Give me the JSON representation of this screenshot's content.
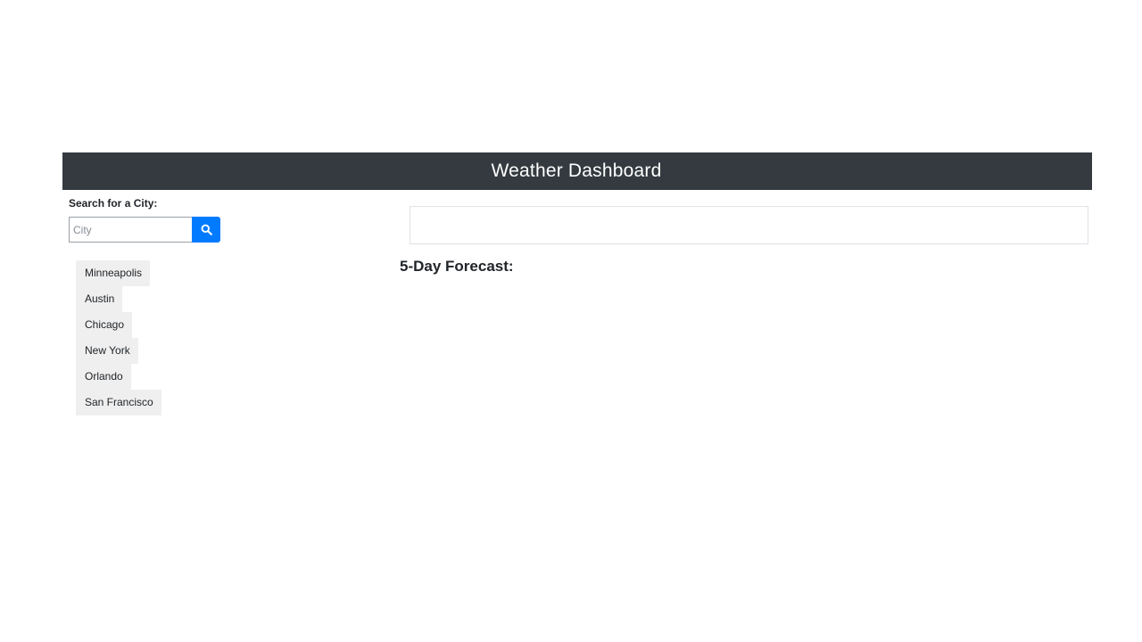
{
  "header": {
    "title": "Weather Dashboard"
  },
  "search": {
    "label": "Search for a City:",
    "placeholder": "City",
    "value": "",
    "button_icon": "search-icon"
  },
  "history": {
    "cities": [
      "Minneapolis",
      "Austin",
      "Chicago",
      "New York",
      "Orlando",
      "San Francisco"
    ]
  },
  "forecast": {
    "title": "5-Day Forecast:"
  },
  "colors": {
    "navbar": "#343a40",
    "accent": "#007bff",
    "city_button": "#efefef"
  }
}
